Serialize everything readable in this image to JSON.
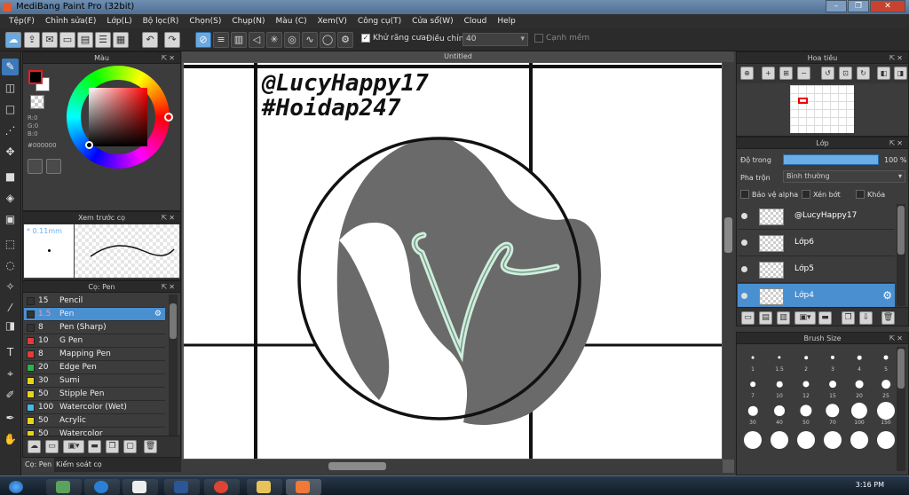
{
  "window": {
    "title": "MediBang Paint Pro (32bit)"
  },
  "menu": [
    "Tệp(F)",
    "Chỉnh sửa(E)",
    "Lớp(L)",
    "Bộ lọc(R)",
    "Chọn(S)",
    "Chụp(N)",
    "Màu (C)",
    "Xem(V)",
    "Công cụ(T)",
    "Cửa sổ(W)",
    "Cloud",
    "Help"
  ],
  "toolbar": {
    "antialias_label": "Khử răng cưa",
    "antialias_checked": true,
    "adjust_label": "Điều chỉnh",
    "adjust_value": "40",
    "smooth_label": "Cạnh mềm",
    "smooth_checked": false
  },
  "color_panel": {
    "title": "Màu",
    "r_label": "R:0",
    "g_label": "G:0",
    "b_label": "B:0",
    "hex": "#000000",
    "fg_color": "#000000",
    "bg_color": "#ffffff"
  },
  "brush_preview": {
    "title": "Xem trước cọ",
    "size_label": "* 0.11mm"
  },
  "brush_panel": {
    "title": "Cọ: Pen",
    "brushes": [
      {
        "size": "15",
        "name": "Pencil",
        "color": "#333333"
      },
      {
        "size": "1.5",
        "name": "Pen",
        "color": "#333333",
        "selected": true
      },
      {
        "size": "8",
        "name": "Pen (Sharp)",
        "color": "#333333"
      },
      {
        "size": "10",
        "name": "G Pen",
        "color": "#e53a3a"
      },
      {
        "size": "8",
        "name": "Mapping Pen",
        "color": "#e53a3a"
      },
      {
        "size": "20",
        "name": "Edge Pen",
        "color": "#2bb24c"
      },
      {
        "size": "30",
        "name": "Sumi",
        "color": "#e7d51a"
      },
      {
        "size": "50",
        "name": "Stipple Pen",
        "color": "#e7d51a"
      },
      {
        "size": "100",
        "name": "Watercolor (Wet)",
        "color": "#45b8e6"
      },
      {
        "size": "50",
        "name": "Acrylic",
        "color": "#e7d51a"
      },
      {
        "size": "50",
        "name": "Watercolor",
        "color": "#e7d51a"
      }
    ]
  },
  "left_tabs": {
    "brush": "Cọ: Pen",
    "control": "Kiểm soát cọ"
  },
  "canvas": {
    "title": "Untitled",
    "watermark_line1": "@LucyHappy17",
    "watermark_line2": "#Hoidap247",
    "logo_letter": "V"
  },
  "navigator": {
    "title": "Hoa tiêu"
  },
  "layers": {
    "title": "Lớp",
    "opacity_label": "Độ trong",
    "opacity_value": "100 %",
    "opacity_fraction": 1.0,
    "blend_label": "Pha trộn",
    "blend_value": "Bình thường",
    "protect_alpha": "Bảo vệ alpha",
    "clipping": "Xén bớt",
    "lock": "Khóa",
    "items": [
      {
        "name": "@LucyHappy17"
      },
      {
        "name": "Lớp6"
      },
      {
        "name": "Lớp5"
      },
      {
        "name": "Lớp4",
        "selected": true
      }
    ]
  },
  "brush_size": {
    "title": "Brush Size",
    "sizes": [
      "1",
      "1.5",
      "2",
      "3",
      "4",
      "5",
      "7",
      "10",
      "12",
      "15",
      "20",
      "25",
      "30",
      "40",
      "50",
      "70",
      "100",
      "150"
    ]
  },
  "taskbar": {
    "clock": "3:16 PM"
  }
}
